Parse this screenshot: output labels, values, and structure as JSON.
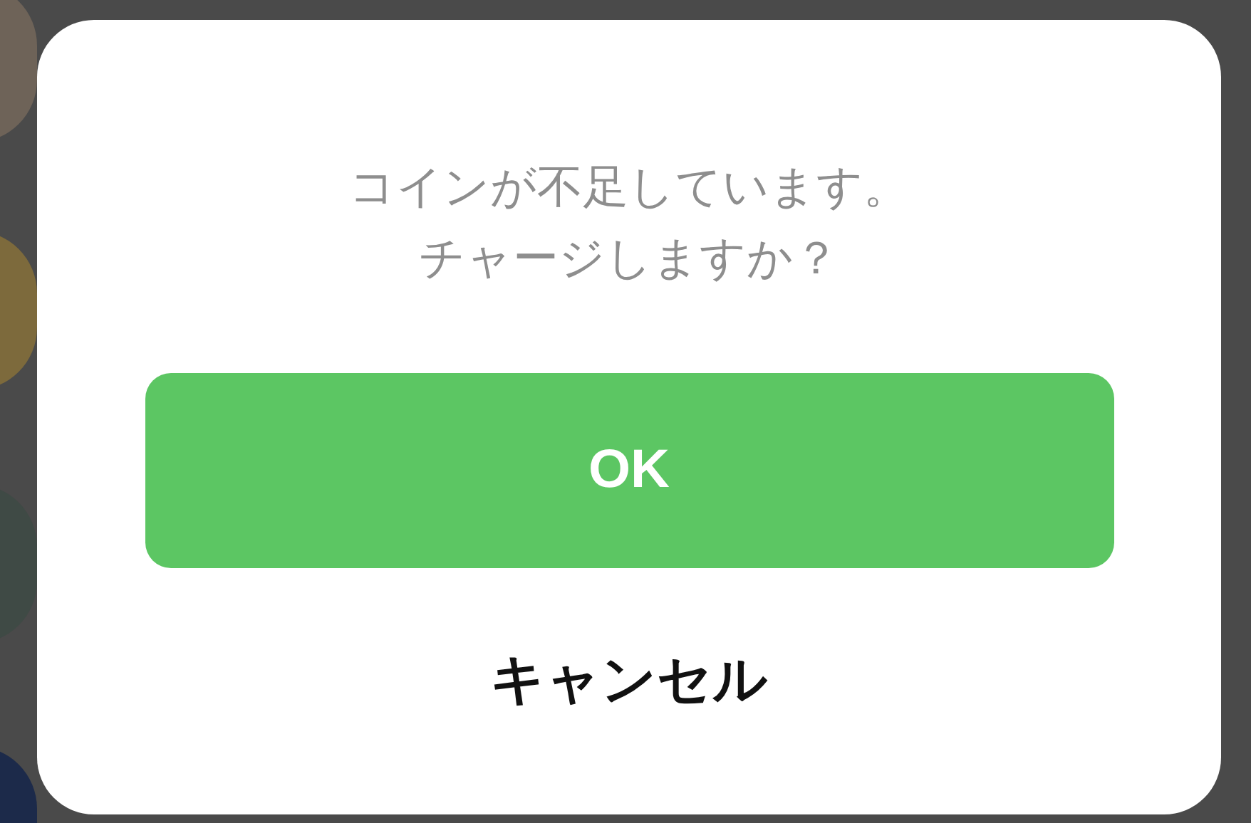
{
  "dialog": {
    "message_lines": [
      "コインが不足しています。",
      "チャージしますか？"
    ],
    "buttons": [
      {
        "label": "OK",
        "kind": "primary"
      },
      {
        "label": "キャンセル",
        "kind": "text"
      }
    ]
  }
}
